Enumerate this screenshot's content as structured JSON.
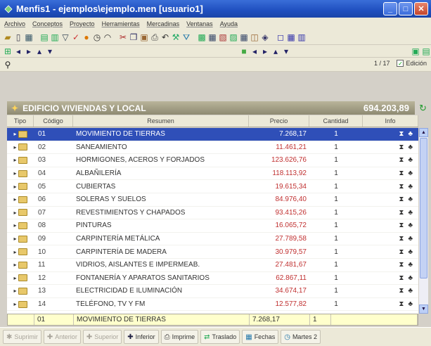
{
  "window": {
    "title": "Menfis1 - ejemplos\\ejemplo.men   [usuario1]"
  },
  "menu": [
    "Archivo",
    "Conceptos",
    "Proyecto",
    "Herramientas",
    "Mercadinas",
    "Ventanas",
    "Ayuda"
  ],
  "nav": {
    "position": "1 / 17",
    "edit_label": "Edición"
  },
  "project": {
    "name": "EDIFICIO VIVIENDAS Y LOCAL",
    "total": "694.203,89"
  },
  "columns": {
    "tipo": "Tipo",
    "codigo": "Código",
    "resumen": "Resumen",
    "precio": "Precio",
    "cantidad": "Cantidad",
    "info": "Info"
  },
  "rows": [
    {
      "codigo": "01",
      "resumen": "MOVIMIENTO DE TIERRAS",
      "precio": "7.268,17",
      "cantidad": "1"
    },
    {
      "codigo": "02",
      "resumen": "SANEAMIENTO",
      "precio": "11.461,21",
      "cantidad": "1"
    },
    {
      "codigo": "03",
      "resumen": "HORMIGONES, ACEROS Y FORJADOS",
      "precio": "123.626,76",
      "cantidad": "1"
    },
    {
      "codigo": "04",
      "resumen": "ALBAÑILERÍA",
      "precio": "118.113,92",
      "cantidad": "1"
    },
    {
      "codigo": "05",
      "resumen": "CUBIERTAS",
      "precio": "19.615,34",
      "cantidad": "1"
    },
    {
      "codigo": "06",
      "resumen": "SOLERAS Y SUELOS",
      "precio": "84.976,40",
      "cantidad": "1"
    },
    {
      "codigo": "07",
      "resumen": "REVESTIMIENTOS Y CHAPADOS",
      "precio": "93.415,26",
      "cantidad": "1"
    },
    {
      "codigo": "08",
      "resumen": "PINTURAS",
      "precio": "16.065,72",
      "cantidad": "1"
    },
    {
      "codigo": "09",
      "resumen": "CARPINTERÍA METÁLICA",
      "precio": "27.789,58",
      "cantidad": "1"
    },
    {
      "codigo": "10",
      "resumen": "CARPINTERÍA DE MADERA",
      "precio": "30.979,57",
      "cantidad": "1"
    },
    {
      "codigo": "11",
      "resumen": "VIDRIOS, AISLANTES E IMPERMEAB.",
      "precio": "27.481,67",
      "cantidad": "1"
    },
    {
      "codigo": "12",
      "resumen": "FONTANERÍA Y APARATOS SANITARIOS",
      "precio": "62.867,11",
      "cantidad": "1"
    },
    {
      "codigo": "13",
      "resumen": "ELECTRICIDAD E ILUMINACIÓN",
      "precio": "34.674,17",
      "cantidad": "1"
    },
    {
      "codigo": "14",
      "resumen": "TELÉFONO, TV Y FM",
      "precio": "12.577,82",
      "cantidad": "1"
    }
  ],
  "editrow": {
    "codigo": "01",
    "resumen": "MOVIMIENTO DE TIERRAS",
    "precio": "7.268,17",
    "cantidad": "1"
  },
  "buttons": {
    "b1": "Suprimir",
    "b2": "Anterior",
    "b3": "Superior",
    "b4": "Inferior",
    "b5": "Imprime",
    "b6": "Traslado",
    "b7": "Fechas",
    "b8": "Martes 2"
  },
  "colors": {
    "title_bar": "#1f4fbf",
    "selection": "#2f4fb8",
    "price_text": "#c03030",
    "project_bar": "#9f9a80"
  }
}
